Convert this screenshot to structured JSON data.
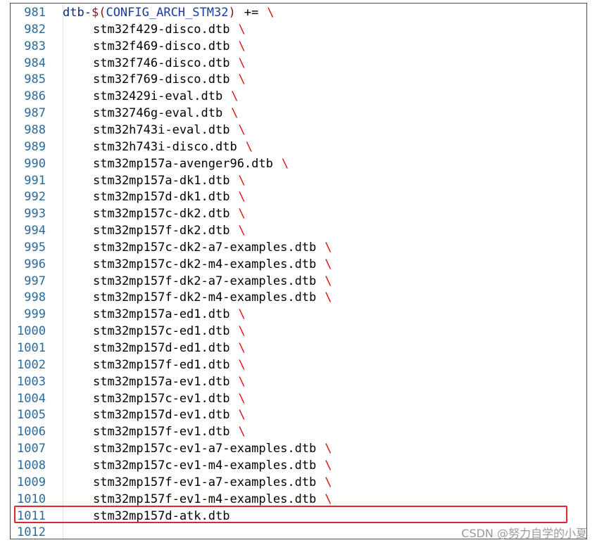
{
  "editor": {
    "first_line": {
      "number": "981",
      "prefix": "dtb-",
      "dollar": "$",
      "open_paren": "(",
      "macro": "CONFIG_ARCH_STM32",
      "close_paren": ")",
      "operator": "+=",
      "backslash": "\\"
    },
    "lines": [
      {
        "number": "982",
        "text": "stm32f429-disco.dtb",
        "backslash": "\\"
      },
      {
        "number": "983",
        "text": "stm32f469-disco.dtb",
        "backslash": "\\"
      },
      {
        "number": "984",
        "text": "stm32f746-disco.dtb",
        "backslash": "\\"
      },
      {
        "number": "985",
        "text": "stm32f769-disco.dtb",
        "backslash": "\\"
      },
      {
        "number": "986",
        "text": "stm32429i-eval.dtb",
        "backslash": "\\"
      },
      {
        "number": "987",
        "text": "stm32746g-eval.dtb",
        "backslash": "\\"
      },
      {
        "number": "988",
        "text": "stm32h743i-eval.dtb",
        "backslash": "\\"
      },
      {
        "number": "989",
        "text": "stm32h743i-disco.dtb",
        "backslash": "\\"
      },
      {
        "number": "990",
        "text": "stm32mp157a-avenger96.dtb",
        "backslash": "\\"
      },
      {
        "number": "991",
        "text": "stm32mp157a-dk1.dtb",
        "backslash": "\\"
      },
      {
        "number": "992",
        "text": "stm32mp157d-dk1.dtb",
        "backslash": "\\"
      },
      {
        "number": "993",
        "text": "stm32mp157c-dk2.dtb",
        "backslash": "\\"
      },
      {
        "number": "994",
        "text": "stm32mp157f-dk2.dtb",
        "backslash": "\\"
      },
      {
        "number": "995",
        "text": "stm32mp157c-dk2-a7-examples.dtb",
        "backslash": "\\"
      },
      {
        "number": "996",
        "text": "stm32mp157c-dk2-m4-examples.dtb",
        "backslash": "\\"
      },
      {
        "number": "997",
        "text": "stm32mp157f-dk2-a7-examples.dtb",
        "backslash": "\\"
      },
      {
        "number": "998",
        "text": "stm32mp157f-dk2-m4-examples.dtb",
        "backslash": "\\"
      },
      {
        "number": "999",
        "text": "stm32mp157a-ed1.dtb",
        "backslash": "\\"
      },
      {
        "number": "1000",
        "text": "stm32mp157c-ed1.dtb",
        "backslash": "\\"
      },
      {
        "number": "1001",
        "text": "stm32mp157d-ed1.dtb",
        "backslash": "\\"
      },
      {
        "number": "1002",
        "text": "stm32mp157f-ed1.dtb",
        "backslash": "\\"
      },
      {
        "number": "1003",
        "text": "stm32mp157a-ev1.dtb",
        "backslash": "\\"
      },
      {
        "number": "1004",
        "text": "stm32mp157c-ev1.dtb",
        "backslash": "\\"
      },
      {
        "number": "1005",
        "text": "stm32mp157d-ev1.dtb",
        "backslash": "\\"
      },
      {
        "number": "1006",
        "text": "stm32mp157f-ev1.dtb",
        "backslash": "\\"
      },
      {
        "number": "1007",
        "text": "stm32mp157c-ev1-a7-examples.dtb",
        "backslash": "\\"
      },
      {
        "number": "1008",
        "text": "stm32mp157c-ev1-m4-examples.dtb",
        "backslash": "\\"
      },
      {
        "number": "1009",
        "text": "stm32mp157f-ev1-a7-examples.dtb",
        "backslash": "\\"
      },
      {
        "number": "1010",
        "text": "stm32mp157f-ev1-m4-examples.dtb",
        "backslash": "\\"
      },
      {
        "number": "1011",
        "text": "stm32mp157d-atk.dtb",
        "backslash": ""
      },
      {
        "number": "1012",
        "text": "",
        "backslash": ""
      }
    ]
  },
  "highlight": {
    "color": "#e0262c",
    "line": "1011"
  },
  "watermark": "CSDN @努力自学的小夏"
}
